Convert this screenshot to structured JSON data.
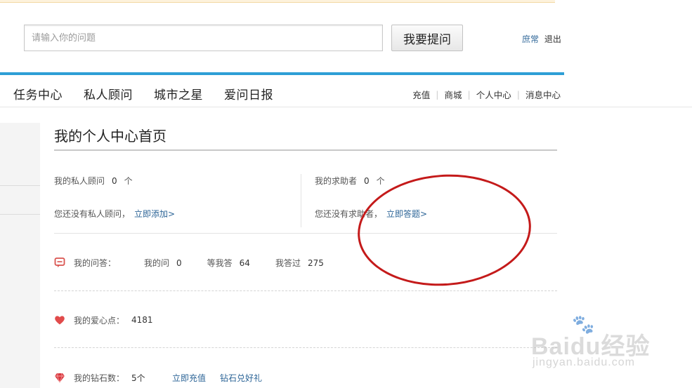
{
  "search": {
    "placeholder": "请输入你的问题",
    "button_label": "我要提问"
  },
  "user": {
    "name": "庶常",
    "logout_label": "退出"
  },
  "nav": {
    "main_items": [
      "任务中心",
      "私人顾问",
      "城市之星",
      "爱问日报"
    ],
    "sub_items": [
      "充值",
      "商城",
      "个人中心",
      "消息中心"
    ]
  },
  "page": {
    "title": "我的个人中心首页"
  },
  "advisors": {
    "label": "我的私人顾问",
    "count": "0",
    "unit": "个",
    "empty_text": "您还没有私人顾问，",
    "add_link": "立即添加>"
  },
  "helpers": {
    "label": "我的求助者",
    "count": "0",
    "unit": "个",
    "empty_text": "您还没有求助者，",
    "answer_link": "立即答题>"
  },
  "qa": {
    "label": "我的问答：",
    "items": [
      {
        "label": "我的问",
        "value": "0"
      },
      {
        "label": "等我答",
        "value": "64"
      },
      {
        "label": "我答过",
        "value": "275"
      }
    ]
  },
  "love": {
    "label": "我的爱心点：",
    "value": "4181"
  },
  "diamond": {
    "label": "我的钻石数：",
    "value": "5个",
    "recharge_link": "立即充值",
    "exchange_link": "钻石兑好礼"
  },
  "watermark": {
    "brand": "Baidu经验",
    "url": "jingyan.baidu.com"
  },
  "colors": {
    "accent_blue": "#2e9fd6",
    "link_blue": "#2d6597",
    "annotation_red": "#c41a1a"
  }
}
